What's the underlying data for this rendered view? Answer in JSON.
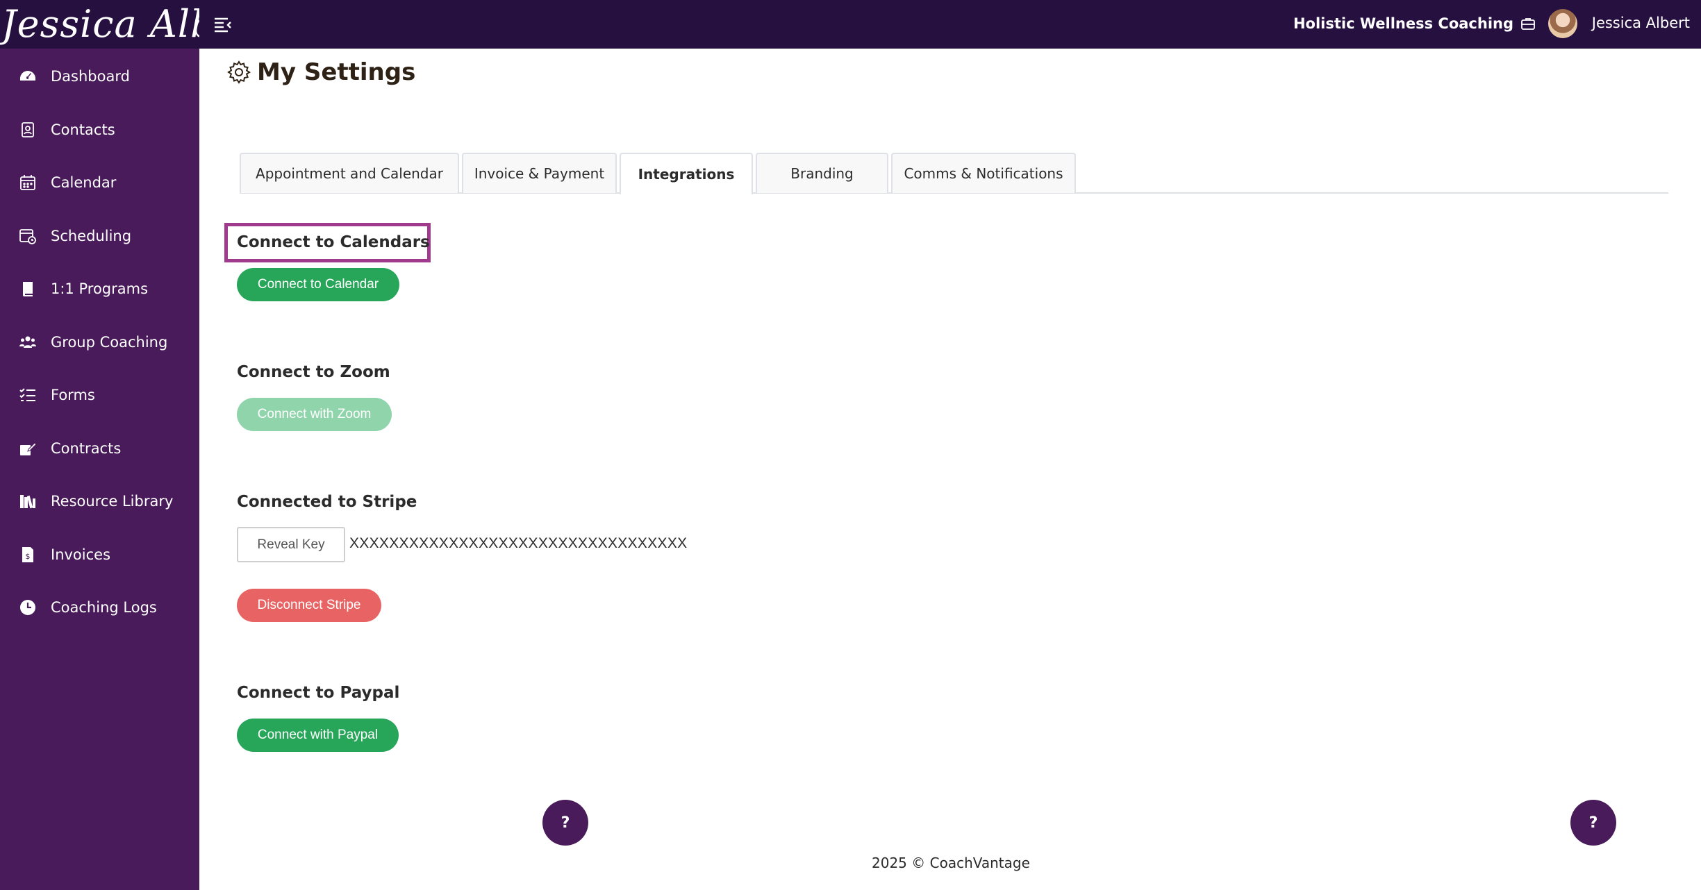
{
  "header": {
    "logo_text": "Jessica Albert",
    "org_name": "Holistic Wellness Coaching",
    "user_name": "Jessica Albert"
  },
  "sidebar": {
    "items": [
      {
        "label": "Dashboard",
        "icon": "dashboard-gauge-icon"
      },
      {
        "label": "Contacts",
        "icon": "contact-book-icon"
      },
      {
        "label": "Calendar",
        "icon": "calendar-icon"
      },
      {
        "label": "Scheduling",
        "icon": "calendar-clock-icon"
      },
      {
        "label": "1:1 Programs",
        "icon": "book-icon"
      },
      {
        "label": "Group Coaching",
        "icon": "users-icon"
      },
      {
        "label": "Forms",
        "icon": "checklist-icon"
      },
      {
        "label": "Contracts",
        "icon": "signature-icon"
      },
      {
        "label": "Resource Library",
        "icon": "library-icon"
      },
      {
        "label": "Invoices",
        "icon": "invoice-icon"
      },
      {
        "label": "Coaching Logs",
        "icon": "clock-icon"
      }
    ]
  },
  "page": {
    "title": "My Settings"
  },
  "tabs": [
    {
      "label": "Appointment and Calendar",
      "active": false
    },
    {
      "label": "Invoice & Payment",
      "active": false
    },
    {
      "label": "Integrations",
      "active": true
    },
    {
      "label": "Branding",
      "active": false
    },
    {
      "label": "Comms & Notifications",
      "active": false
    }
  ],
  "integrations": {
    "calendar": {
      "title": "Connect to Calendars",
      "button": "Connect to Calendar"
    },
    "zoom": {
      "title": "Connect to Zoom",
      "button": "Connect with Zoom"
    },
    "stripe": {
      "title": "Connected to Stripe",
      "reveal_button": "Reveal Key",
      "masked_key": "XXXXXXXXXXXXXXXXXXXXXXXXXXXXXXXXXX",
      "disconnect_button": "Disconnect Stripe"
    },
    "paypal": {
      "title": "Connect to Paypal",
      "button": "Connect with Paypal"
    }
  },
  "help": {
    "label": "?"
  },
  "footer": {
    "text": "2025 © CoachVantage"
  },
  "colors": {
    "topbar": "#26103f",
    "sidebar": "#4a1b5a",
    "green": "#27a65a",
    "green_disabled": "#8fd4ab",
    "red": "#e86464",
    "highlight": "#a03a8c"
  }
}
